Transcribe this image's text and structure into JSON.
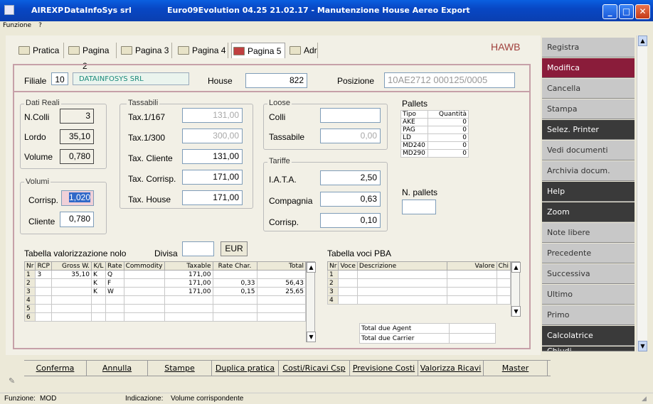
{
  "window": {
    "app": "AIREXP",
    "company": "DataInfoSys srl",
    "title": "Euro09Evolution 04.25 21.02.17 - Manutenzione House Aereo Export"
  },
  "menu": [
    "Funzione",
    "?"
  ],
  "tabs": [
    {
      "label": "Pratica"
    },
    {
      "label": "Pagina 2"
    },
    {
      "label": "Pagina 3"
    },
    {
      "label": "Pagina 4"
    },
    {
      "label": "Pagina 5"
    },
    {
      "label": "Adr"
    }
  ],
  "hawb": "HAWB",
  "header": {
    "filiale_label": "Filiale",
    "filiale": "10",
    "filiale_name": "DATAINFOSYS SRL",
    "house_label": "House",
    "house": "822",
    "posizione_label": "Posizione",
    "posizione": "10AE2712 000125/0005"
  },
  "dati_reali": {
    "title": "Dati Reali",
    "ncolli_label": "N.Colli",
    "ncolli": "3",
    "lordo_label": "Lordo",
    "lordo": "35,10",
    "volume_label": "Volume",
    "volume": "0,780"
  },
  "volumi": {
    "title": "Volumi",
    "corrisp_label": "Corrisp.",
    "corrisp": "1,020",
    "cliente_label": "Cliente",
    "cliente": "0,780"
  },
  "tassabili": {
    "title": "Tassabili",
    "t167_label": "Tax.1/167",
    "t167": "131,00",
    "t300_label": "Tax.1/300",
    "t300": "300,00",
    "cliente_label": "Tax. Cliente",
    "cliente": "131,00",
    "corrisp_label": "Tax. Corrisp.",
    "corrisp": "171,00",
    "house_label": "Tax. House",
    "house": "171,00"
  },
  "loose": {
    "title": "Loose",
    "colli_label": "Colli",
    "colli": "",
    "tassabile_label": "Tassabile",
    "tassabile": "0,00"
  },
  "tariffe": {
    "title": "Tariffe",
    "iata_label": "I.A.T.A.",
    "iata": "2,50",
    "compagnia_label": "Compagnia",
    "compagnia": "0,63",
    "corrisp_label": "Corrisp.",
    "corrisp": "0,10"
  },
  "pallets": {
    "title": "Pallets",
    "col_tipo": "Tipo",
    "col_qta": "Quantità",
    "rows": [
      {
        "tipo": "AKE",
        "qta": "0"
      },
      {
        "tipo": "PAG",
        "qta": "0"
      },
      {
        "tipo": "LD",
        "qta": "0"
      },
      {
        "tipo": "MD240",
        "qta": "0"
      },
      {
        "tipo": "MD290",
        "qta": "0"
      }
    ],
    "npallets_label": "N. pallets",
    "npallets": ""
  },
  "nolo": {
    "title": "Tabella valorizzazione nolo",
    "divisa_label": "Divisa",
    "divisa": "",
    "eur": "EUR",
    "headers": [
      "Nr",
      "RCP",
      "Gross W.",
      "K/L",
      "Rate",
      "Commodity",
      "Taxable",
      "Rate Char.",
      "Total"
    ],
    "rows": [
      [
        "1",
        "3",
        "35,10",
        "K",
        "Q",
        "",
        "171,00",
        "",
        ""
      ],
      [
        "2",
        "",
        "",
        "K",
        "F",
        "",
        "171,00",
        "0,33",
        "56,43"
      ],
      [
        "3",
        "",
        "",
        "K",
        "W",
        "",
        "171,00",
        "0,15",
        "25,65"
      ],
      [
        "4",
        "",
        "",
        "",
        "",
        "",
        "",
        "",
        ""
      ],
      [
        "5",
        "",
        "",
        "",
        "",
        "",
        "",
        "",
        ""
      ],
      [
        "6",
        "",
        "",
        "",
        "",
        "",
        "",
        "",
        ""
      ]
    ]
  },
  "pba": {
    "title": "Tabella voci PBA",
    "headers": [
      "Nr",
      "Voce",
      "Descrizione",
      "Valore",
      "Chi"
    ],
    "rows": [
      [
        "1",
        "",
        "",
        "",
        ""
      ],
      [
        "2",
        "",
        "",
        "",
        ""
      ],
      [
        "3",
        "",
        "",
        "",
        ""
      ],
      [
        "4",
        "",
        "",
        "",
        ""
      ]
    ],
    "total_agent": "Total due Agent",
    "total_carrier": "Total due Carrier"
  },
  "sidebar": [
    "Registra",
    "Modifica",
    "Cancella",
    "Stampa",
    "Selez. Printer",
    "Vedi documenti",
    "Archivia docum.",
    "Help",
    "Zoom",
    "Note libere",
    "Precedente",
    "Successiva",
    "Ultimo",
    "Primo",
    "Calcolatrice",
    "Chiudi"
  ],
  "bottom": [
    "Conferma",
    "Annulla",
    "Stampe",
    "Duplica pratica",
    "Costi/Ricavi Csp",
    "Previsione Costi",
    "Valorizza Ricavi",
    "Master"
  ],
  "status": {
    "funzione_label": "Funzione:",
    "funzione": "MOD",
    "indicazione_label": "Indicazione:",
    "indicazione": "Volume corrispondente"
  },
  "colors": {
    "selected": "#8a1c3a",
    "dark_button": "#3a3a3a",
    "accent_text": "#a0403c"
  }
}
